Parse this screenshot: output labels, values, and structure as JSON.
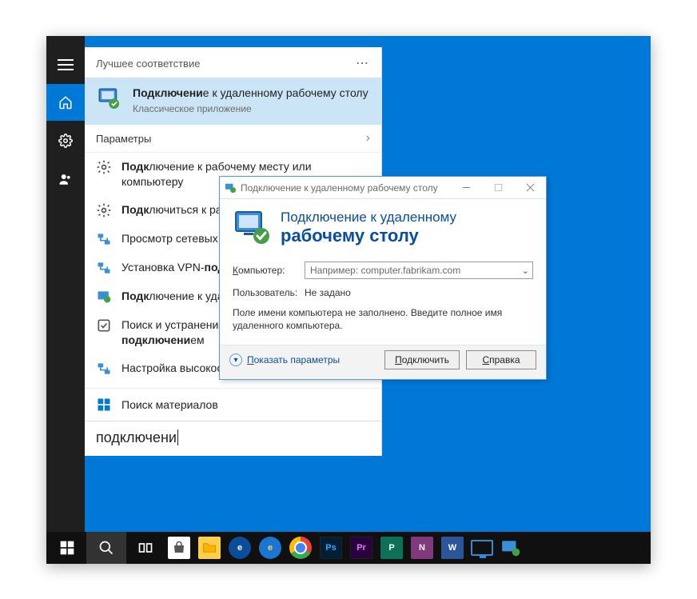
{
  "start": {
    "best_header": "Лучшее соответствие",
    "best_match": {
      "title_pre": "Подключени",
      "title_bold": "е",
      "title_post": " к удаленному рабочему столу",
      "subtitle": "Классическое приложение"
    },
    "params_header": "Параметры",
    "results": [
      "Подключение к рабочему месту или компьютеру",
      "Подключиться к рабочей сети или домену",
      "Просмотр сетевых подключений",
      "Установка VPN-подключения",
      "Подключение к удаленному рабочему столу",
      "Поиск и устранение проблем с сетью и подключением",
      "Настройка высокоскоростного подключения"
    ],
    "store_row": "Поиск материалов",
    "search_value": "подключени"
  },
  "rdp": {
    "titlebar": "Подключение к удаленному рабочему столу",
    "banner_line1": "Подключение к удаленному",
    "banner_line2": "рабочему столу",
    "computer_label": "Компьютер:",
    "computer_placeholder": "Например: computer.fabrikam.com",
    "user_label": "Пользователь:",
    "user_value": "Не задано",
    "hint": "Поле имени компьютера не заполнено. Введите полное имя удаленного компьютера.",
    "show_params": "Показать параметры",
    "btn_connect": "Подключить",
    "btn_help": "Справка"
  }
}
